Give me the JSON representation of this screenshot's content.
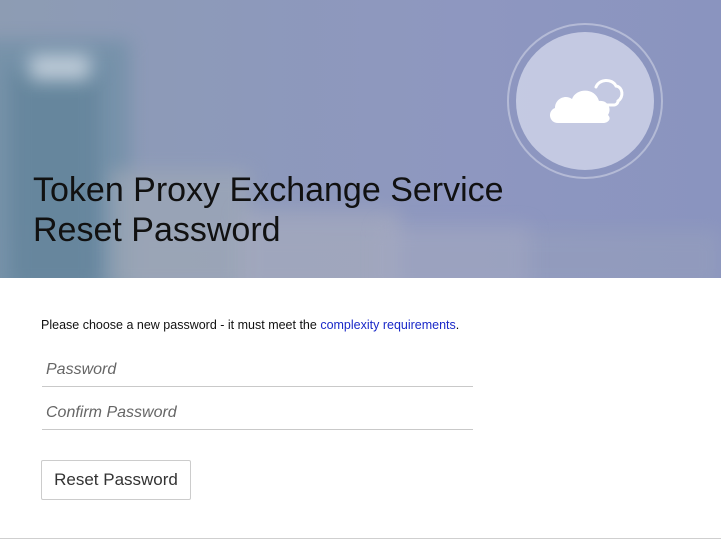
{
  "header": {
    "title_line1": "Token Proxy Exchange Service",
    "title_line2": "Reset Password",
    "badge_icon": "cloud-icon"
  },
  "form": {
    "instructions_prefix": "Please choose a new password - it must meet the ",
    "instructions_link": "complexity requirements",
    "instructions_suffix": ".",
    "password_placeholder": "Password",
    "password_value": "",
    "confirm_placeholder": "Confirm Password",
    "confirm_value": "",
    "submit_label": "Reset Password"
  },
  "colors": {
    "link": "#1a29c8",
    "banner": "#8d99bb",
    "badge": "#ced2e8"
  }
}
